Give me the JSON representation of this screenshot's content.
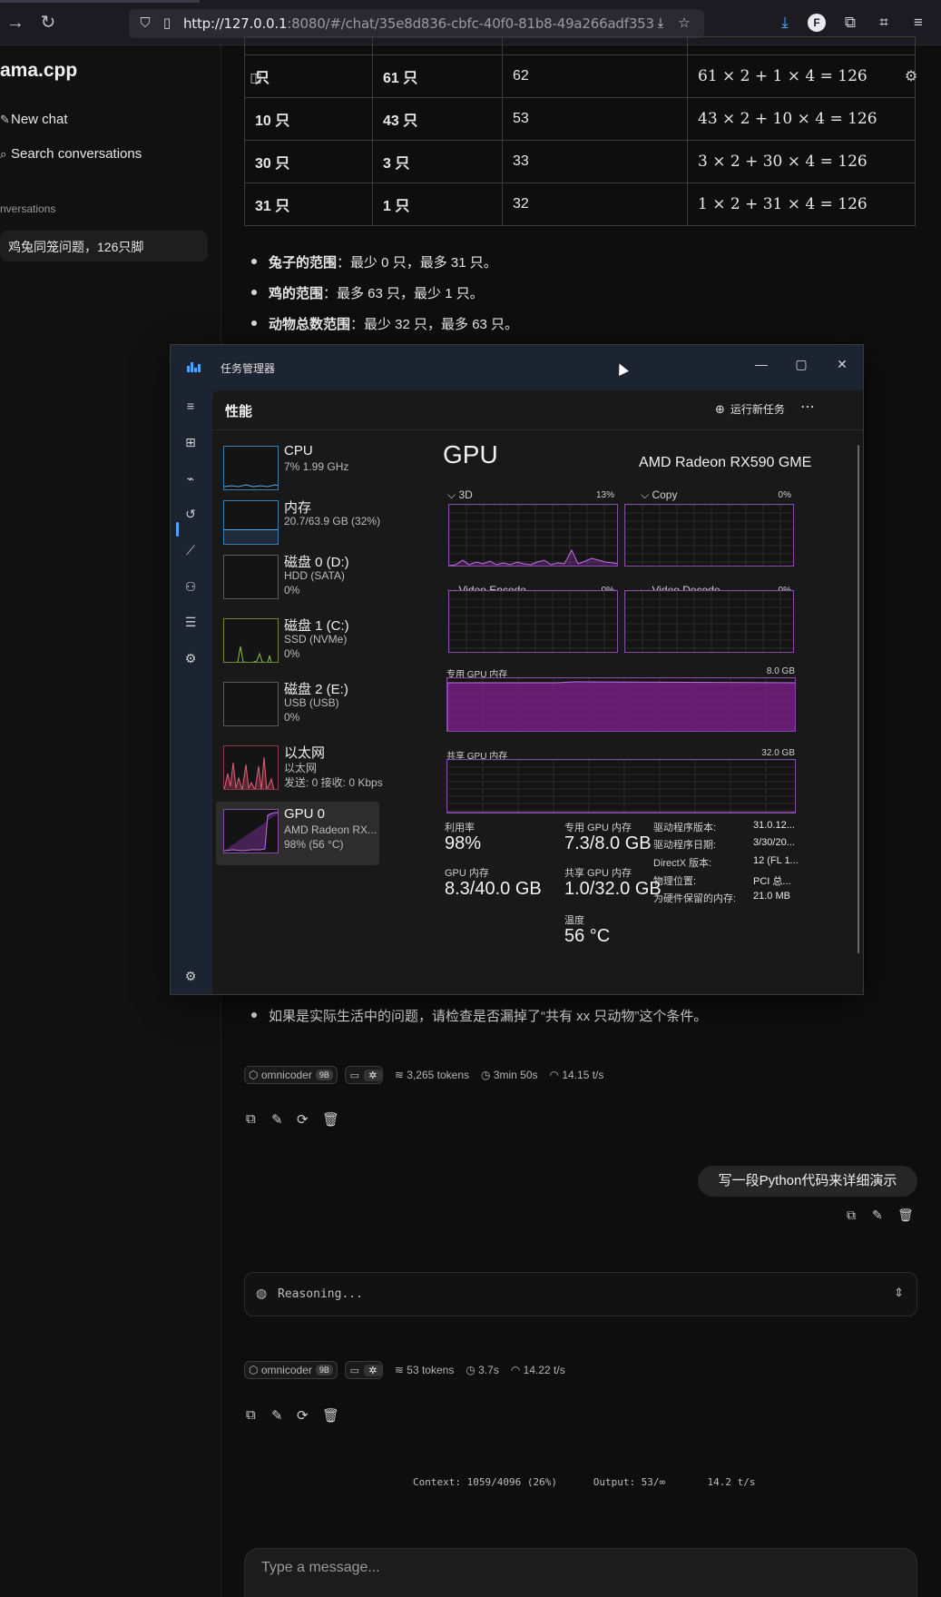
{
  "browser": {
    "url_host": "http://127.0.0.1",
    "url_rest": ":8080/#/chat/35e8d836-cbfc-40f0-81b8-49a266adf353",
    "profile_initial": "F"
  },
  "sidebar": {
    "app_title": "ama.cpp",
    "new_chat": "New chat",
    "search": "Search conversations",
    "section_label": "nversations",
    "conversations": [
      "鸡兔同笼问题，126只脚"
    ]
  },
  "table": {
    "rows": [
      {
        "rabbit": "只",
        "chicken": "61 只",
        "total": "62",
        "formula": "61 × 2 + 1 × 4 = 126"
      },
      {
        "rabbit": "10 只",
        "chicken": "43 只",
        "total": "53",
        "formula": "43 × 2 + 10 × 4 = 126"
      },
      {
        "rabbit": "30 只",
        "chicken": "3 只",
        "total": "33",
        "formula": "3 × 2 + 30 × 4 = 126"
      },
      {
        "rabbit": "31 只",
        "chicken": "1 只",
        "total": "32",
        "formula": "1 × 2 + 31 × 4 = 126"
      }
    ]
  },
  "bullets": [
    {
      "bold": "兔子的范围",
      "rest": "：最少 0 只，最多 31 只。"
    },
    {
      "bold": "鸡的范围",
      "rest": "：最多 63 只，最少 1 只。"
    },
    {
      "bold": "动物总数范围",
      "rest": "：最少 32 只，最多 63 只。"
    }
  ],
  "bullet_last": "如果是实际生活中的问题，请检查是否漏掉了“共有 xx 只动物”这个条件。",
  "message1_meta": {
    "model": "omnicoder",
    "badge": "9B",
    "tokens": "3,265 tokens",
    "time": "3min 50s",
    "speed": "14.15 t/s"
  },
  "user_message": "写一段Python代码来详细演示",
  "reasoning_label": "Reasoning...",
  "message2_meta": {
    "model": "omnicoder",
    "badge": "9B",
    "tokens": "53 tokens",
    "time": "3.7s",
    "speed": "14.22 t/s"
  },
  "context_bar": {
    "context": "Context: 1059/4096 (26%)",
    "output": "Output: 53/∞",
    "speed": "14.2 t/s"
  },
  "composer_placeholder": "Type a message...",
  "task_manager": {
    "window_title": "任务管理器",
    "page_title": "性能",
    "run_new_task": "运行新任务",
    "devices": [
      {
        "name": "CPU",
        "line1": "7%  1.99 GHz",
        "line2": ""
      },
      {
        "name": "内存",
        "line1": "20.7/63.9 GB (32%)",
        "line2": ""
      },
      {
        "name": "磁盘 0 (D:)",
        "line1": "HDD (SATA)",
        "line2": "0%"
      },
      {
        "name": "磁盘 1 (C:)",
        "line1": "SSD (NVMe)",
        "line2": "0%"
      },
      {
        "name": "磁盘 2 (E:)",
        "line1": "USB (USB)",
        "line2": "0%"
      },
      {
        "name": "以太网",
        "line1": "以太网",
        "line2": "发送: 0 接收: 0 Kbps"
      },
      {
        "name": "GPU 0",
        "line1": "AMD Radeon RX...",
        "line2": "98% (56 °C)"
      }
    ],
    "gpu_title": "GPU",
    "gpu_model": "AMD Radeon RX590 GME",
    "graphs": {
      "g3d": {
        "label": "3D",
        "pct": "13%"
      },
      "copy": {
        "label": "Copy",
        "pct": "0%"
      },
      "venc": {
        "label": "Video Encode",
        "pct": "0%"
      },
      "vdec": {
        "label": "Video Decode",
        "pct": "0%"
      },
      "dedicated": {
        "label": "专用 GPU 内存",
        "max": "8.0 GB",
        "level": 0.91
      },
      "shared": {
        "label": "共享 GPU 内存",
        "max": "32.0 GB",
        "level": 0.03
      }
    },
    "stats": {
      "util_label": "利用率",
      "util_value": "98%",
      "ded_label": "专用 GPU 内存",
      "ded_value": "7.3/8.0 GB",
      "gpumem_label": "GPU 内存",
      "gpumem_value": "8.3/40.0 GB",
      "shared_label": "共享 GPU 内存",
      "shared_value": "1.0/32.0 GB",
      "temp_label": "温度",
      "temp_value": "56 °C"
    },
    "details": [
      {
        "k": "驱动程序版本:",
        "v": "31.0.12..."
      },
      {
        "k": "驱动程序日期:",
        "v": "3/30/20..."
      },
      {
        "k": "DirectX 版本:",
        "v": "12 (FL 1..."
      },
      {
        "k": "物理位置:",
        "v": "PCI 总..."
      },
      {
        "k": "为硬件保留的内存:",
        "v": "21.0 MB"
      }
    ]
  }
}
